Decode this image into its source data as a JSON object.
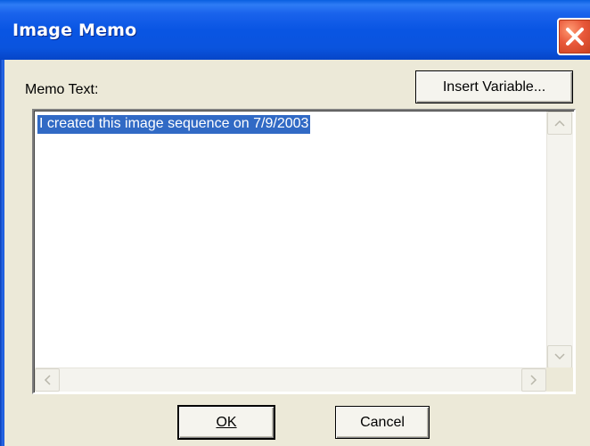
{
  "window": {
    "title": "Image Memo"
  },
  "form": {
    "memo_label": "Memo Text:",
    "insert_variable_label": "Insert Variable...",
    "memo_value": "I created this image sequence on 7/9/2003"
  },
  "buttons": {
    "ok_label": "OK",
    "cancel_label": "Cancel"
  },
  "icons": {
    "close": "close-icon",
    "scroll_up": "chevron-up-icon",
    "scroll_down": "chevron-down-icon",
    "scroll_left": "chevron-left-icon",
    "scroll_right": "chevron-right-icon"
  },
  "colors": {
    "titlebar": "#0955e3",
    "close_button": "#e8583a",
    "selection": "#316ac5",
    "dialog_bg": "#ece9d8"
  }
}
